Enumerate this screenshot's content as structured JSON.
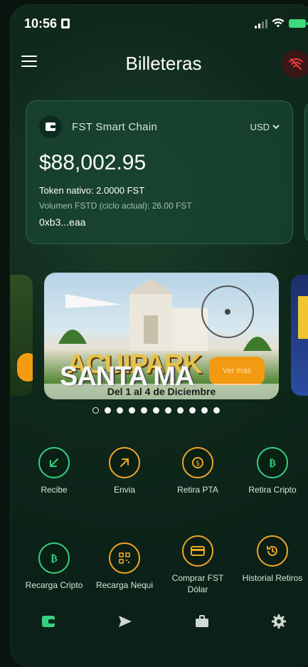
{
  "status": {
    "time": "10:56"
  },
  "header": {
    "title": "Billeteras"
  },
  "wallet": {
    "chain": "FST Smart Chain",
    "currency": "USD",
    "balance": "$88,002.95",
    "native_token": "Token nativo: 2.0000 FST",
    "volume": "Volumen FSTD (ciclo actual): 26.00 FST",
    "address": "0xb3...eaa"
  },
  "banner": {
    "title_line1": "ACUIPARK",
    "title_line2": "SANTA MA",
    "subtitle": "Del 1 al 4 de Diciembre",
    "cta": "Ver más"
  },
  "carousel": {
    "count": 11,
    "active": 0
  },
  "actions_row1": [
    {
      "label": "Recibe",
      "icon": "arrow-down-left-icon"
    },
    {
      "label": "Envia",
      "icon": "arrow-up-right-icon"
    },
    {
      "label": "Retira PTA",
      "icon": "currency-exchange-icon"
    },
    {
      "label": "Retira Cripto",
      "icon": "bitcoin-icon"
    }
  ],
  "actions_row2": [
    {
      "label": "Recarga Cripto",
      "icon": "bitcoin-icon"
    },
    {
      "label": "Recarga Nequi",
      "icon": "qr-code-icon"
    },
    {
      "label": "Comprar FST Dólar",
      "icon": "card-icon"
    },
    {
      "label": "Historial Retiros",
      "icon": "history-icon"
    }
  ],
  "colors": {
    "accent_green": "#35d07f",
    "accent_orange": "#f0a52a",
    "wifi_off_red": "#e23b3b"
  }
}
